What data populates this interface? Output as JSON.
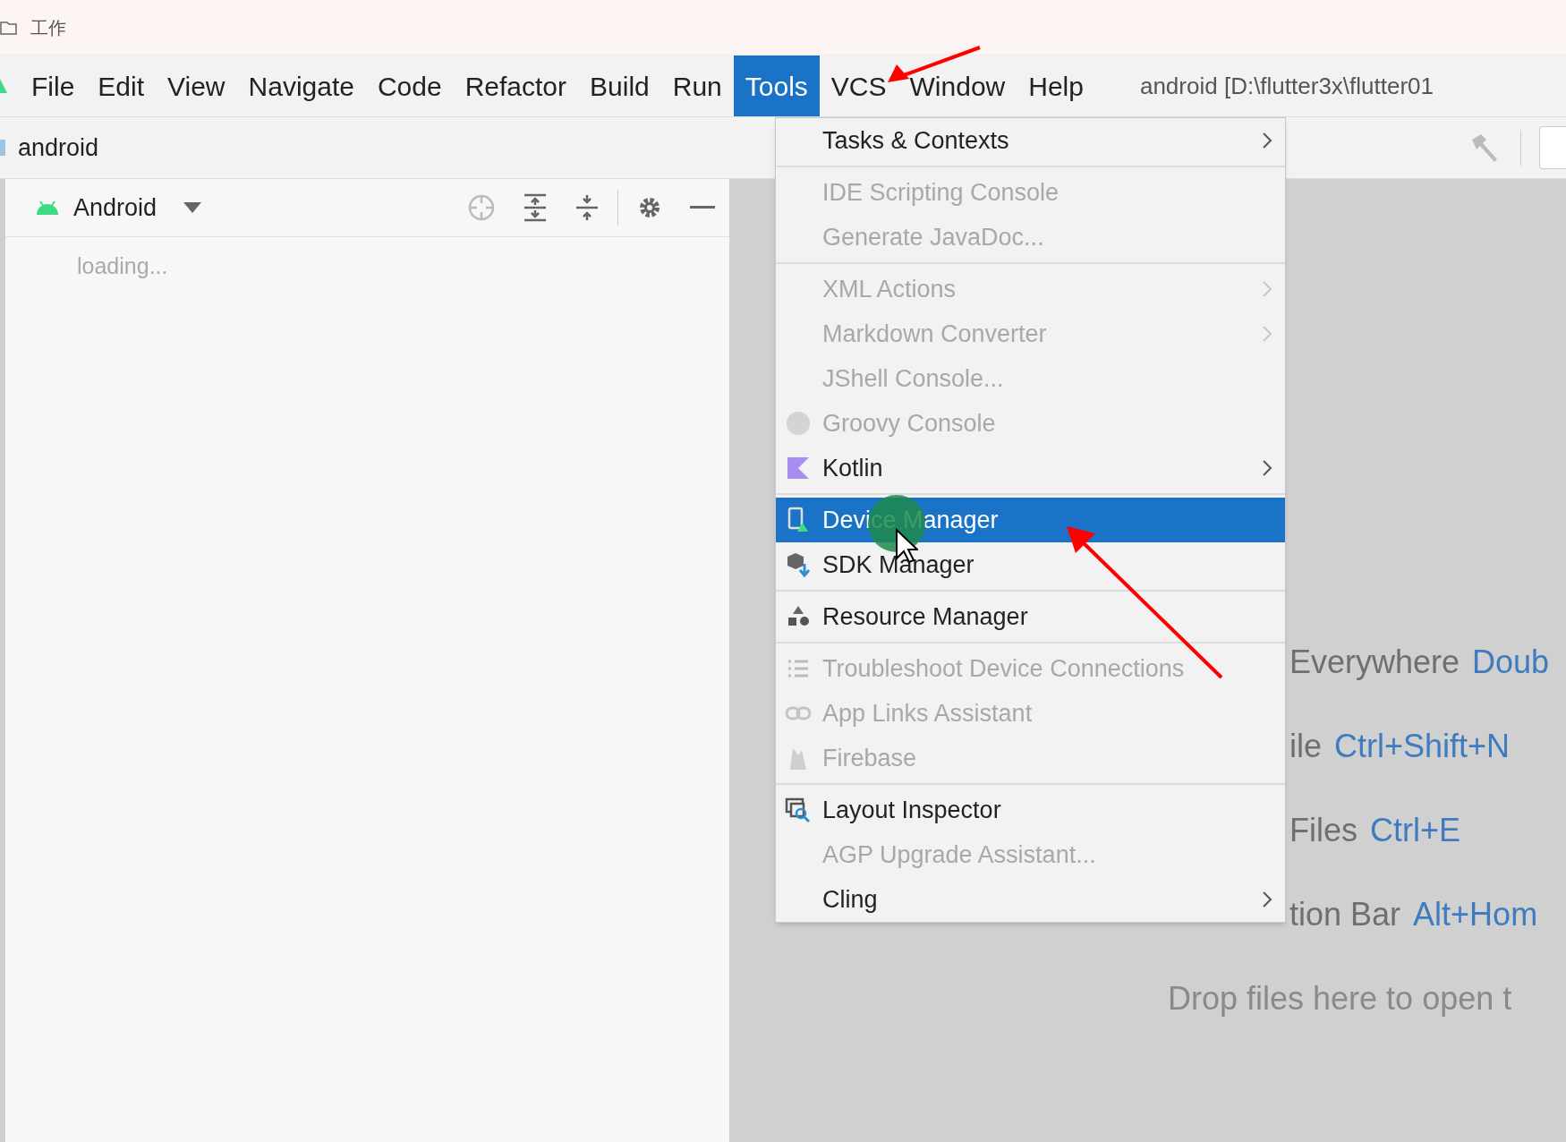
{
  "window": {
    "title": "工作"
  },
  "menu_bar": {
    "items": [
      {
        "label": "File",
        "selected": false
      },
      {
        "label": "Edit",
        "selected": false
      },
      {
        "label": "View",
        "selected": false
      },
      {
        "label": "Navigate",
        "selected": false
      },
      {
        "label": "Code",
        "selected": false
      },
      {
        "label": "Refactor",
        "selected": false
      },
      {
        "label": "Build",
        "selected": false
      },
      {
        "label": "Run",
        "selected": false
      },
      {
        "label": "Tools",
        "selected": true
      },
      {
        "label": "VCS",
        "selected": false
      },
      {
        "label": "Window",
        "selected": false
      },
      {
        "label": "Help",
        "selected": false
      }
    ],
    "project_path": "android [D:\\flutter3x\\flutter01"
  },
  "nav_bar": {
    "project": "android"
  },
  "project_panel": {
    "view": "Android",
    "status": "loading..."
  },
  "tools_menu": {
    "groups": [
      [
        {
          "label": "Tasks & Contexts",
          "kind": "plain",
          "disabled": false,
          "submenu": true,
          "selected": false
        }
      ],
      [
        {
          "label": "IDE Scripting Console",
          "kind": "plain",
          "disabled": true,
          "submenu": false,
          "selected": false
        },
        {
          "label": "Generate JavaDoc...",
          "kind": "plain",
          "disabled": true,
          "submenu": false,
          "selected": false
        }
      ],
      [
        {
          "label": "XML Actions",
          "kind": "plain",
          "disabled": true,
          "submenu": true,
          "selected": false
        },
        {
          "label": "Markdown Converter",
          "kind": "plain",
          "disabled": true,
          "submenu": true,
          "selected": false
        },
        {
          "label": "JShell Console...",
          "kind": "plain",
          "disabled": true,
          "submenu": false,
          "selected": false
        },
        {
          "label": "Groovy Console",
          "kind": "groovy",
          "disabled": true,
          "submenu": false,
          "selected": false
        },
        {
          "label": "Kotlin",
          "kind": "kotlin",
          "disabled": false,
          "submenu": true,
          "selected": false
        }
      ],
      [
        {
          "label": "Device Manager",
          "kind": "device",
          "disabled": false,
          "submenu": false,
          "selected": true
        },
        {
          "label": "SDK Manager",
          "kind": "sdk",
          "disabled": false,
          "submenu": false,
          "selected": false
        }
      ],
      [
        {
          "label": "Resource Manager",
          "kind": "resource",
          "disabled": false,
          "submenu": false,
          "selected": false
        }
      ],
      [
        {
          "label": "Troubleshoot Device Connections",
          "kind": "list",
          "disabled": true,
          "submenu": false,
          "selected": false
        },
        {
          "label": "App Links Assistant",
          "kind": "link",
          "disabled": true,
          "submenu": false,
          "selected": false
        },
        {
          "label": "Firebase",
          "kind": "firebase",
          "disabled": true,
          "submenu": false,
          "selected": false
        }
      ],
      [
        {
          "label": "Layout Inspector",
          "kind": "layout",
          "disabled": false,
          "submenu": false,
          "selected": false
        },
        {
          "label": "AGP Upgrade Assistant...",
          "kind": "plain",
          "disabled": true,
          "submenu": false,
          "selected": false
        },
        {
          "label": "Cling",
          "kind": "plain",
          "disabled": false,
          "submenu": true,
          "selected": false
        }
      ]
    ]
  },
  "editor_hints": [
    {
      "kind": "hint",
      "text": "Everywhere",
      "shortcut": "Doub"
    },
    {
      "kind": "hint",
      "text": "ile",
      "shortcut": "Ctrl+Shift+N"
    },
    {
      "kind": "hint",
      "text": "Files",
      "shortcut": "Ctrl+E"
    },
    {
      "kind": "hint",
      "text": "tion Bar",
      "shortcut": "Alt+Hom"
    },
    {
      "kind": "drop",
      "text": "Drop files here to open t"
    }
  ]
}
